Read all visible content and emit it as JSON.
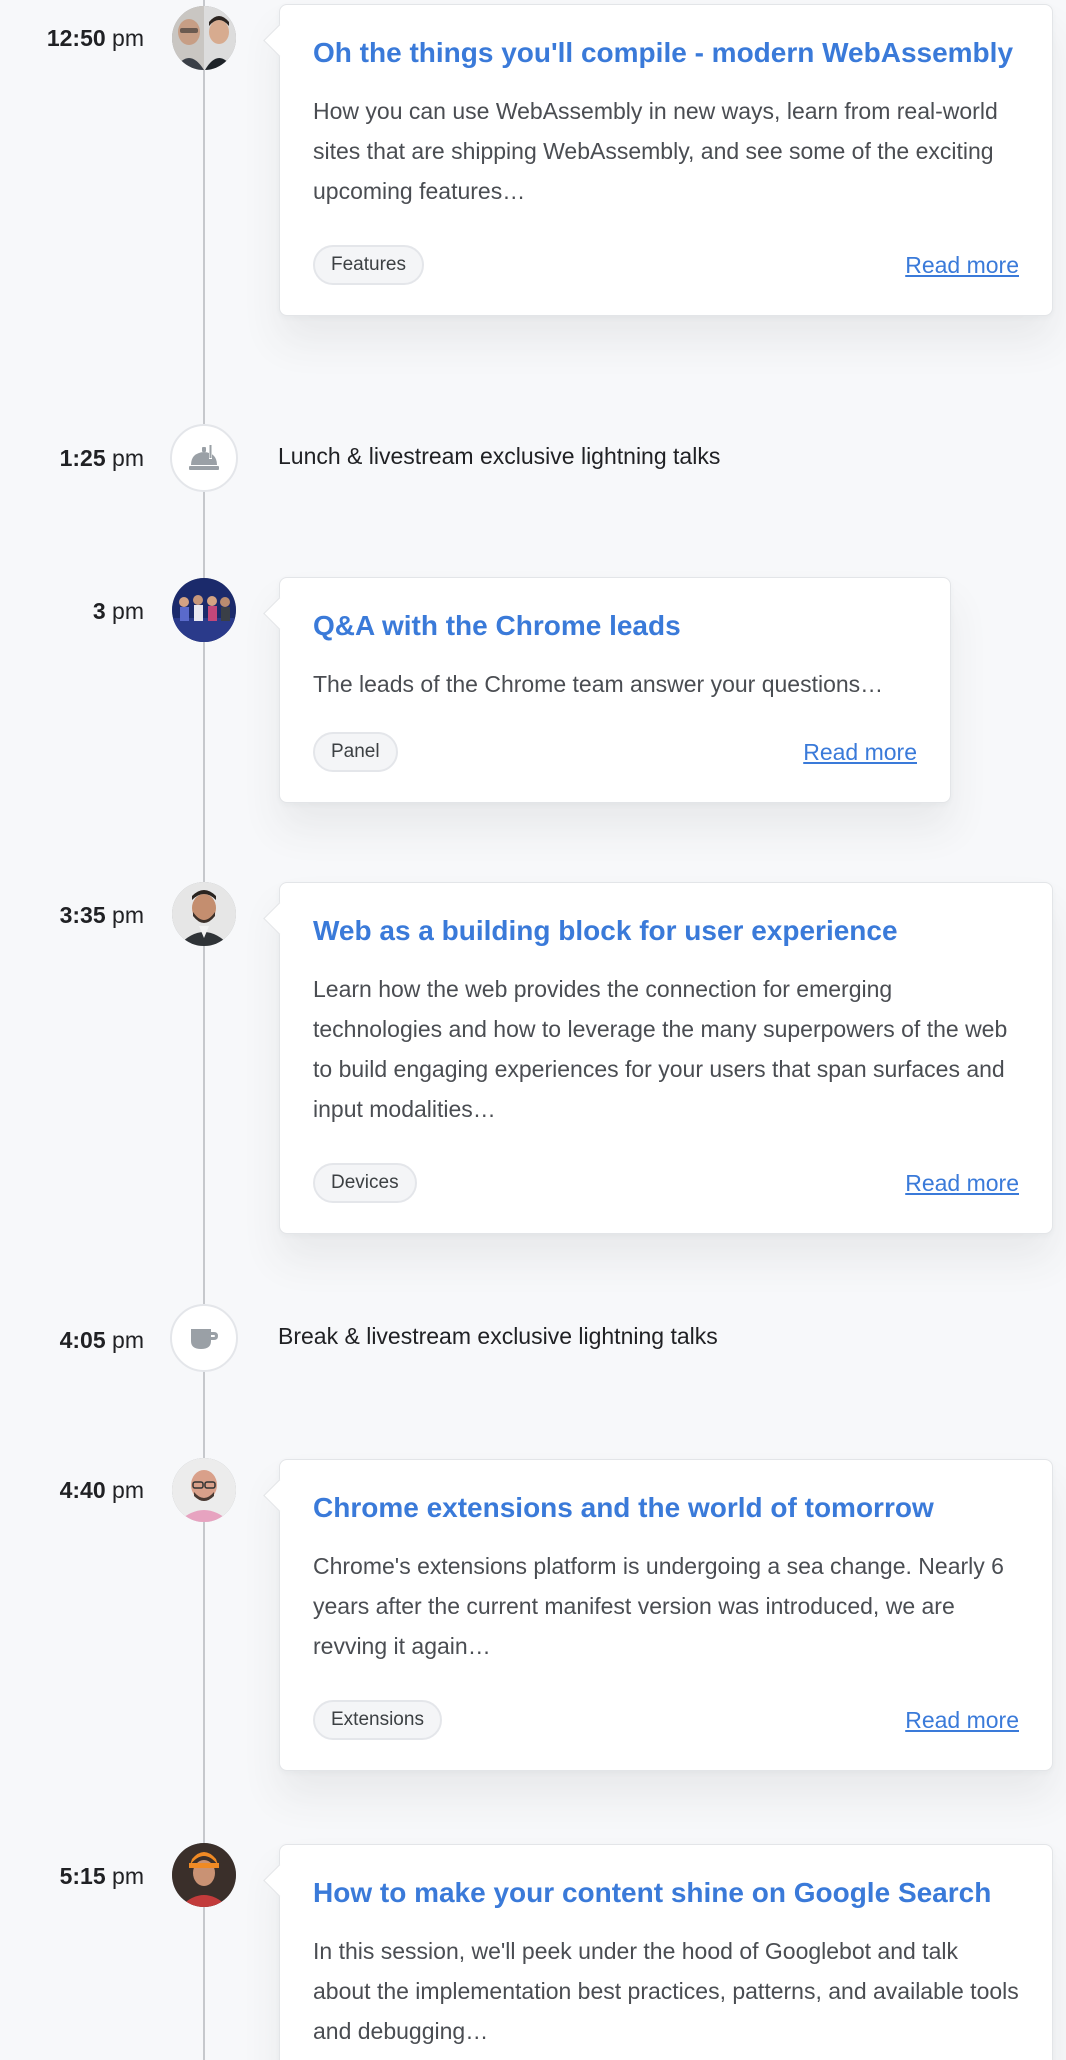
{
  "schedule": [
    {
      "time_main": "12:50",
      "time_suffix": "pm",
      "title": "Oh the things you'll compile - modern WebAssembly",
      "description": "How you can use WebAssembly in new ways, learn from real-world sites that are shipping WebAssembly, and see some of the exciting upcoming features…",
      "tag": "Features",
      "read_more": "Read more",
      "avatar": "speaker-photo-two-men"
    },
    {
      "time_main": "1:25",
      "time_suffix": "pm",
      "break_text": "Lunch & livestream exclusive lightning talks",
      "icon": "food-tray-icon"
    },
    {
      "time_main": "3",
      "time_suffix": "pm",
      "title": "Q&A with the Chrome leads",
      "description": "The leads of the Chrome team answer your questions…",
      "tag": "Panel",
      "read_more": "Read more",
      "avatar": "panel-group-photo"
    },
    {
      "time_main": "3:35",
      "time_suffix": "pm",
      "title": "Web as a building block for user experience",
      "description": "Learn how the web provides the connection for emerging technologies and how to leverage the many superpowers of the web to build engaging experiences for your users that span surfaces and input modalities…",
      "tag": "Devices",
      "read_more": "Read more",
      "avatar": "speaker-photo-man-beard"
    },
    {
      "time_main": "4:05",
      "time_suffix": "pm",
      "break_text": "Break & livestream exclusive lightning talks",
      "icon": "coffee-cup-icon"
    },
    {
      "time_main": "4:40",
      "time_suffix": "pm",
      "title": "Chrome extensions and the world of tomorrow",
      "description": "Chrome's extensions platform is undergoing a sea change. Nearly 6 years after the current manifest version was introduced, we are revving it again…",
      "tag": "Extensions",
      "read_more": "Read more",
      "avatar": "speaker-photo-bald-man-glasses"
    },
    {
      "time_main": "5:15",
      "time_suffix": "pm",
      "title": "How to make your content shine on Google Search",
      "description": "In this session, we'll peek under the hood of Googlebot and talk about the implementation best practices, patterns, and available tools and debugging…",
      "avatar": "speaker-photo-orange-hat"
    }
  ],
  "colors": {
    "accent": "#3a7ad9",
    "background": "#f7f8fa",
    "timeline": "#c6c8cc"
  }
}
